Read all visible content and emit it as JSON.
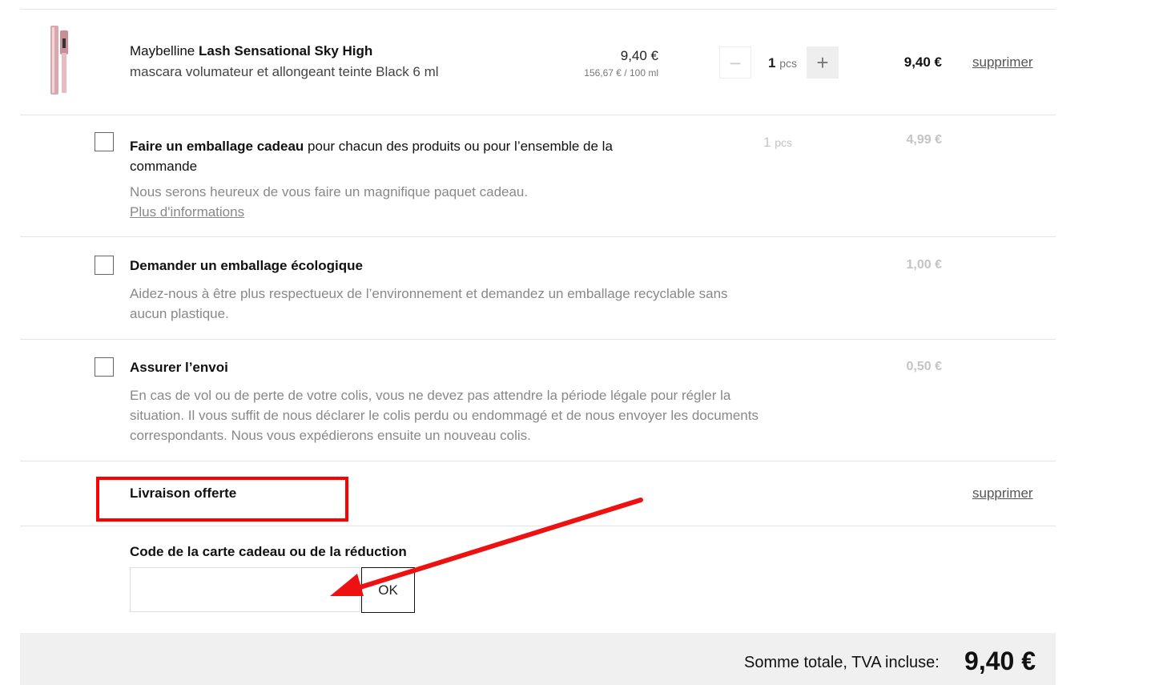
{
  "product": {
    "brand": "Maybelline",
    "name": "Lash Sensational Sky High",
    "description": "mascara volumateur et allongeant teinte Black 6 ml",
    "unit_price": "9,40 €",
    "price_per_unit": "156,67 € / 100 ml",
    "qty": "1",
    "qty_unit": "pcs",
    "minus_label": "−",
    "plus_label": "+",
    "line_total": "9,40 €",
    "remove_label": "supprimer"
  },
  "options": {
    "gift": {
      "title_bold": "Faire un emballage cadeau",
      "title_rest": " pour chacun des produits ou pour l’ensemble de la",
      "title_line2": "commande",
      "desc": "Nous serons heureux de vous faire un magnifique paquet cadeau.",
      "more_link": "Plus d'informations",
      "qty": "1",
      "qty_unit": "pcs",
      "price": "4,99 €"
    },
    "eco": {
      "title": "Demander un emballage écologique",
      "desc_line1": "Aidez-nous à être plus respectueux de l’environnement et demandez un emballage recyclable sans",
      "desc_line2": "aucun plastique.",
      "price": "1,00 €"
    },
    "insure": {
      "title": "Assurer l’envoi",
      "desc_line1": "En cas de vol ou de perte de votre colis, vous ne devez pas attendre la période légale pour régler la",
      "desc_line2": "situation. Il vous suffit de nous déclarer le colis perdu ou endommagé et de nous envoyer les documents",
      "desc_line3": "correspondants. Nous vous expédierons ensuite un nouveau colis.",
      "price": "0,50 €"
    }
  },
  "shipping": {
    "label": "Livraison offerte",
    "remove_label": "supprimer"
  },
  "voucher": {
    "label": "Code de la carte cadeau ou de la réduction",
    "input_value": "",
    "ok_label": "OK"
  },
  "total": {
    "label": "Somme totale, TVA incluse:",
    "value": "9,40 €"
  },
  "colors": {
    "highlight": "#ff0000",
    "total_bg": "#f0f0f0"
  }
}
